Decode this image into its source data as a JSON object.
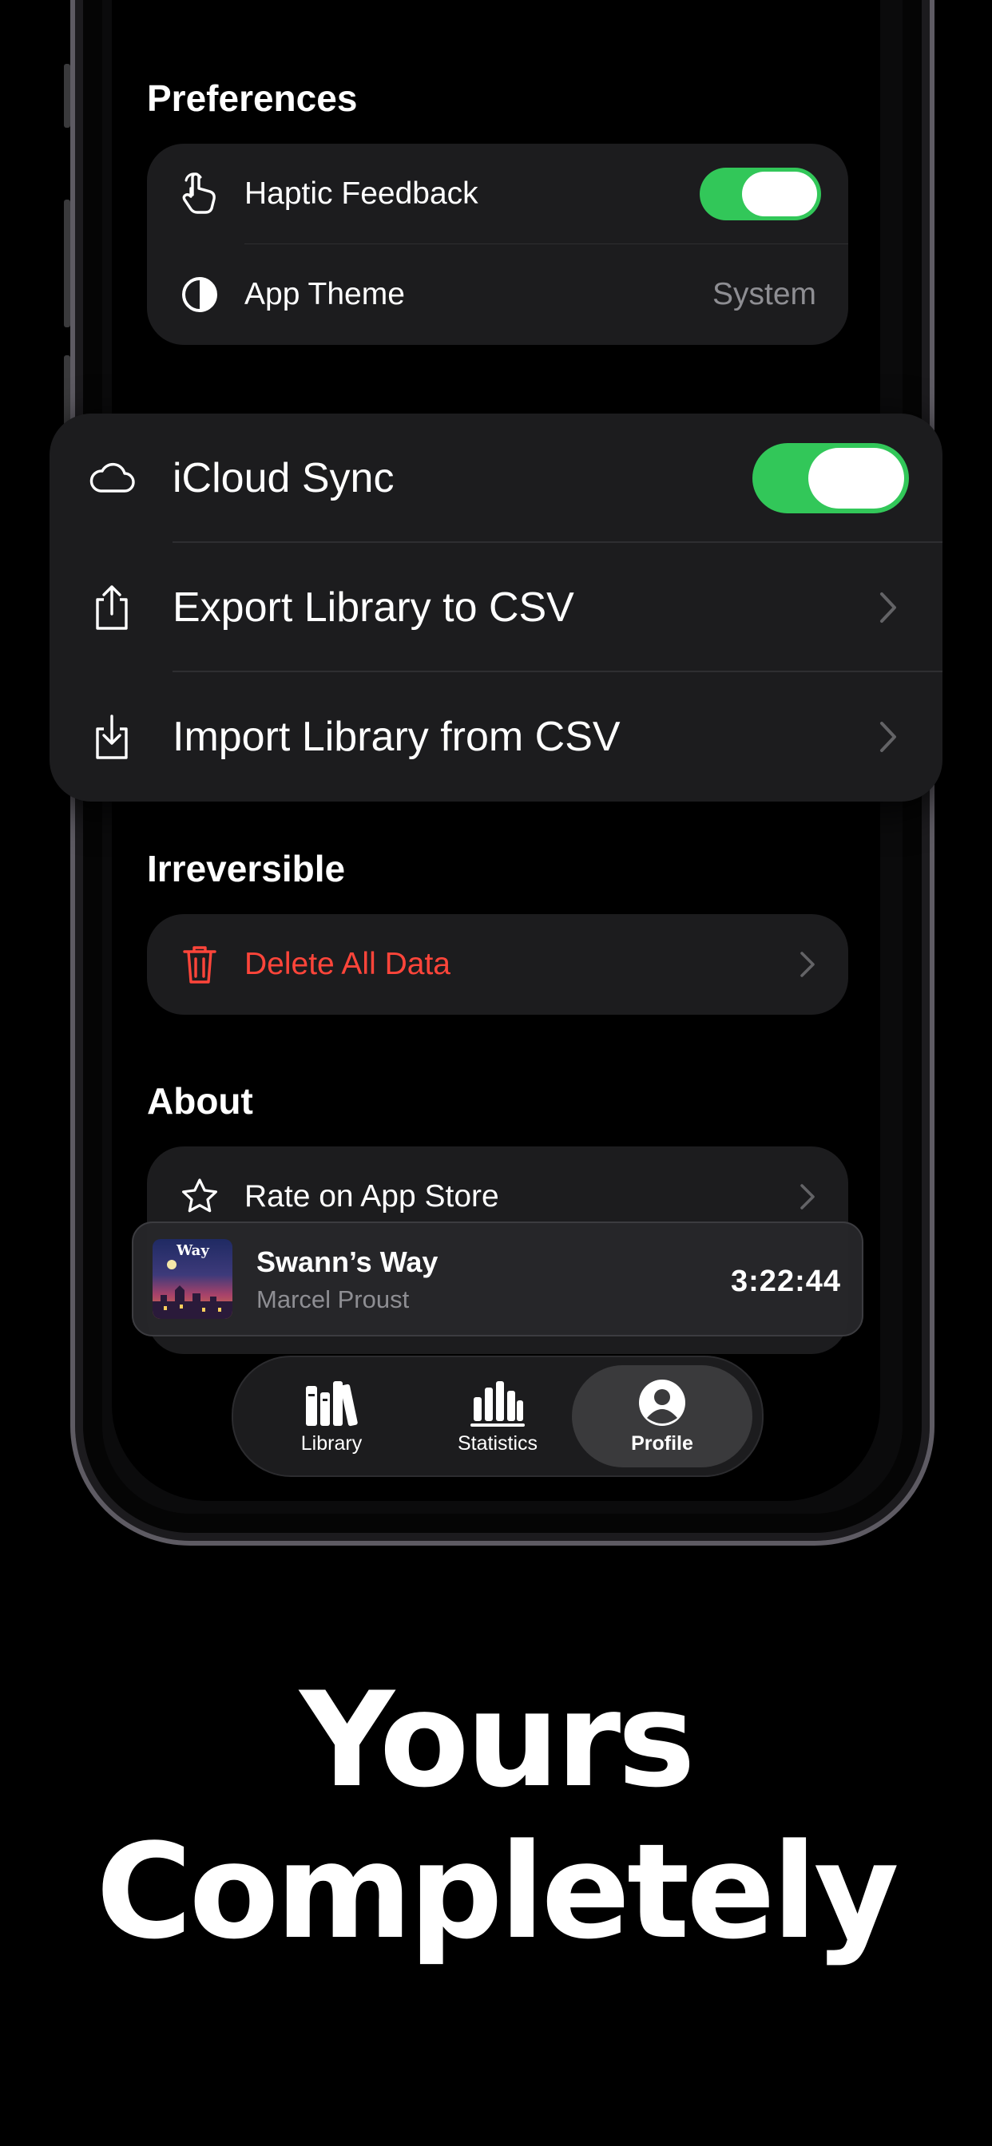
{
  "preferences": {
    "title": "Preferences",
    "haptic_label": "Haptic Feedback",
    "haptic_on": true,
    "theme_label": "App Theme",
    "theme_value": "System"
  },
  "sync_popup": {
    "icloud_label": "iCloud Sync",
    "icloud_on": true,
    "export_label": "Export Library to CSV",
    "import_label": "Import Library from CSV"
  },
  "irreversible": {
    "title": "Irreversible",
    "delete_label": "Delete All Data",
    "danger_color": "#ff453a"
  },
  "about": {
    "title": "About",
    "rate_label": "Rate on App Store"
  },
  "mini_player": {
    "cover_text": "Way",
    "title": "Swann’s Way",
    "author": "Marcel Proust",
    "time": "3:22:44"
  },
  "tabs": [
    {
      "label": "Library",
      "icon": "books-icon",
      "active": false
    },
    {
      "label": "Statistics",
      "icon": "bar-chart-icon",
      "active": false
    },
    {
      "label": "Profile",
      "icon": "person-circle-icon",
      "active": true
    }
  ],
  "headline": {
    "line1": "Yours",
    "line2": "Completely"
  },
  "colors": {
    "toggle_on": "#32c759",
    "card_bg": "#1c1c1e",
    "secondary_text": "#8e8e93"
  }
}
